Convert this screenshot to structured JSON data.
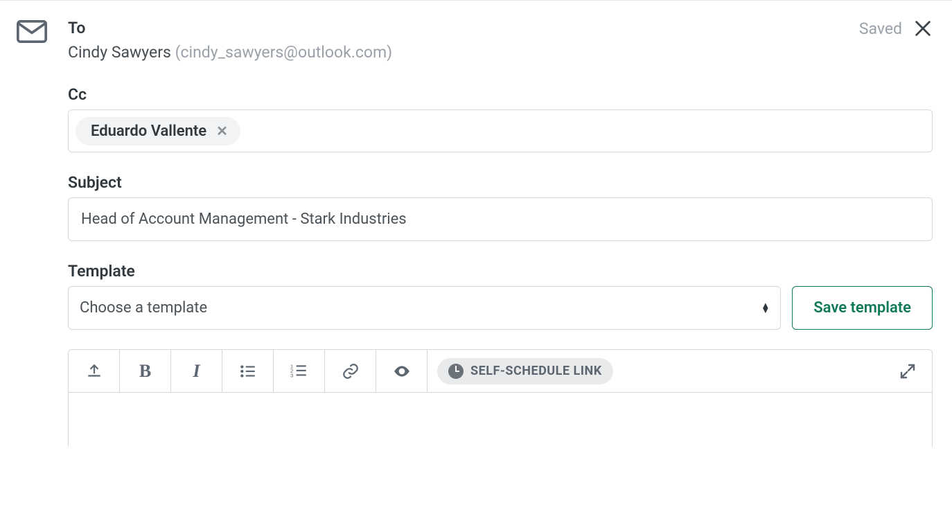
{
  "header": {
    "to_label": "To",
    "recipient_name": "Cindy Sawyers",
    "recipient_email": "(cindy_sawyers@outlook.com)",
    "saved_status": "Saved"
  },
  "cc": {
    "label": "Cc",
    "chips": [
      {
        "name": "Eduardo Vallente"
      }
    ]
  },
  "subject": {
    "label": "Subject",
    "value": "Head of Account Management - Stark Industries"
  },
  "template": {
    "label": "Template",
    "placeholder": "Choose a template",
    "save_button": "Save template"
  },
  "toolbar": {
    "self_schedule_label": "SELF-SCHEDULE LINK"
  }
}
